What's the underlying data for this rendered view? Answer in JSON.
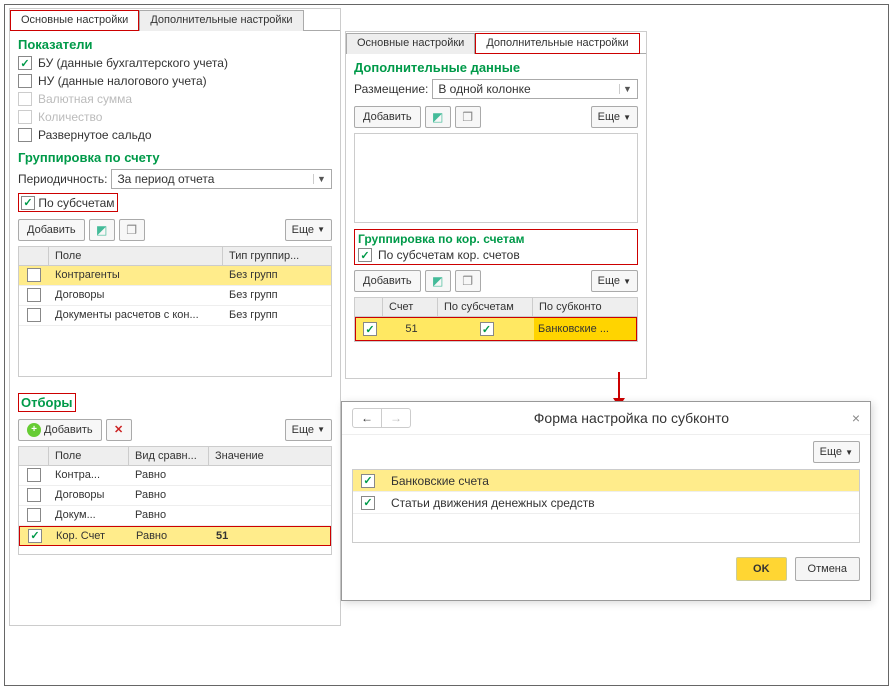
{
  "tabs": {
    "main": "Основные настройки",
    "extra": "Дополнительные настройки"
  },
  "left": {
    "indicators_title": "Показатели",
    "ind_bu": "БУ (данные бухгалтерского учета)",
    "ind_nu": "НУ (данные налогового учета)",
    "ind_val": "Валютная сумма",
    "ind_qty": "Количество",
    "ind_rev": "Развернутое сальдо",
    "group_title": "Группировка по счету",
    "period_label": "Периодичность:",
    "period_value": "За период отчета",
    "sub_chk": "По субсчетам",
    "add": "Добавить",
    "more": "Еще",
    "grp_col_field": "Поле",
    "grp_col_type": "Тип группир...",
    "grp_rows": [
      {
        "f": "Контрагенты",
        "t": "Без групп"
      },
      {
        "f": "Договоры",
        "t": "Без групп"
      },
      {
        "f": "Документы расчетов с кон...",
        "t": "Без групп"
      }
    ],
    "filters_title": "Отборы",
    "flt_col_field": "Поле",
    "flt_col_cmp": "Вид сравн...",
    "flt_col_val": "Значение",
    "flt_rows": [
      {
        "on": false,
        "f": "Контра...",
        "c": "Равно",
        "v": ""
      },
      {
        "on": false,
        "f": "Договоры",
        "c": "Равно",
        "v": ""
      },
      {
        "on": false,
        "f": "Докум...",
        "c": "Равно",
        "v": ""
      },
      {
        "on": true,
        "f": "Кор. Счет",
        "c": "Равно",
        "v": "51"
      }
    ]
  },
  "right": {
    "extra_title": "Дополнительные данные",
    "place_label": "Размещение:",
    "place_value": "В одной колонке",
    "add": "Добавить",
    "more": "Еще",
    "kor_title": "Группировка по кор. счетам",
    "kor_chk": "По субсчетам кор. счетов",
    "kor_col_acc": "Счет",
    "kor_col_sub": "По субсчетам",
    "kor_col_subk": "По субконто",
    "kor_row_acc": "51",
    "kor_row_subk": "Банковские ..."
  },
  "popup": {
    "title": "Форма настройка по субконто",
    "more": "Еще",
    "row1": "Банковские счета",
    "row2": "Статьи движения денежных средств",
    "ok": "OK",
    "cancel": "Отмена"
  }
}
